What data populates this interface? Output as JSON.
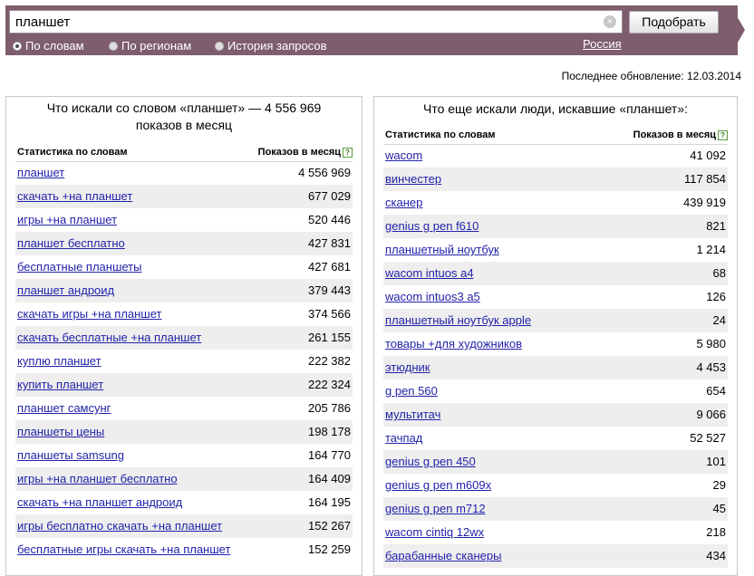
{
  "search": {
    "query": "планшет",
    "submit_label": "Подобрать",
    "clear_icon": "×",
    "modes": [
      "По словам",
      "По регионам",
      "История запросов"
    ],
    "selected_mode": "По словам",
    "region": "Россия"
  },
  "updated": "Последнее обновление: 12.03.2014",
  "left_panel": {
    "title_line1": "Что искали со словом «планшет» — 4 556 969",
    "title_line2": "показов в месяц",
    "col_words": "Статистика по словам",
    "col_shows": "Показов в месяц",
    "help_icon": "?",
    "rows": [
      {
        "phrase": "планшет",
        "count": "4 556 969"
      },
      {
        "phrase": "скачать +на планшет",
        "count": "677 029"
      },
      {
        "phrase": "игры +на планшет",
        "count": "520 446"
      },
      {
        "phrase": "планшет бесплатно",
        "count": "427 831"
      },
      {
        "phrase": "бесплатные планшеты",
        "count": "427 681"
      },
      {
        "phrase": "планшет андроид",
        "count": "379 443"
      },
      {
        "phrase": "скачать игры +на планшет",
        "count": "374 566"
      },
      {
        "phrase": "скачать бесплатные +на планшет",
        "count": "261 155"
      },
      {
        "phrase": "куплю планшет",
        "count": "222 382"
      },
      {
        "phrase": "купить планшет",
        "count": "222 324"
      },
      {
        "phrase": "планшет самсунг",
        "count": "205 786"
      },
      {
        "phrase": "планшеты цены",
        "count": "198 178"
      },
      {
        "phrase": "планшеты samsung",
        "count": "164 770"
      },
      {
        "phrase": "игры +на планшет бесплатно",
        "count": "164 409"
      },
      {
        "phrase": "скачать +на планшет андроид",
        "count": "164 195"
      },
      {
        "phrase": "игры бесплатно скачать +на планшет",
        "count": "152 267"
      },
      {
        "phrase": "бесплатные игры скачать +на планшет",
        "count": "152 259"
      }
    ]
  },
  "right_panel": {
    "title": "Что еще искали люди, искавшие «планшет»:",
    "col_words": "Статистика по словам",
    "col_shows": "Показов в месяц",
    "help_icon": "?",
    "rows": [
      {
        "phrase": "wacom",
        "count": "41 092"
      },
      {
        "phrase": "винчестер",
        "count": "117 854"
      },
      {
        "phrase": "сканер",
        "count": "439 919"
      },
      {
        "phrase": "genius g pen f610",
        "count": "821"
      },
      {
        "phrase": "планшетный ноутбук",
        "count": "1 214"
      },
      {
        "phrase": "wacom intuos a4",
        "count": "68"
      },
      {
        "phrase": "wacom intuos3 a5",
        "count": "126"
      },
      {
        "phrase": "планшетный ноутбук apple",
        "count": "24"
      },
      {
        "phrase": "товары +для художников",
        "count": "5 980"
      },
      {
        "phrase": "этюдник",
        "count": "4 453"
      },
      {
        "phrase": "g pen 560",
        "count": "654"
      },
      {
        "phrase": "мультитач",
        "count": "9 066"
      },
      {
        "phrase": "тачпад",
        "count": "52 527"
      },
      {
        "phrase": "genius g pen 450",
        "count": "101"
      },
      {
        "phrase": "genius g pen m609x",
        "count": "29"
      },
      {
        "phrase": "genius g pen m712",
        "count": "45"
      },
      {
        "phrase": "wacom cintiq 12wx",
        "count": "218"
      },
      {
        "phrase": "барабанные сканеры",
        "count": "434"
      }
    ]
  }
}
